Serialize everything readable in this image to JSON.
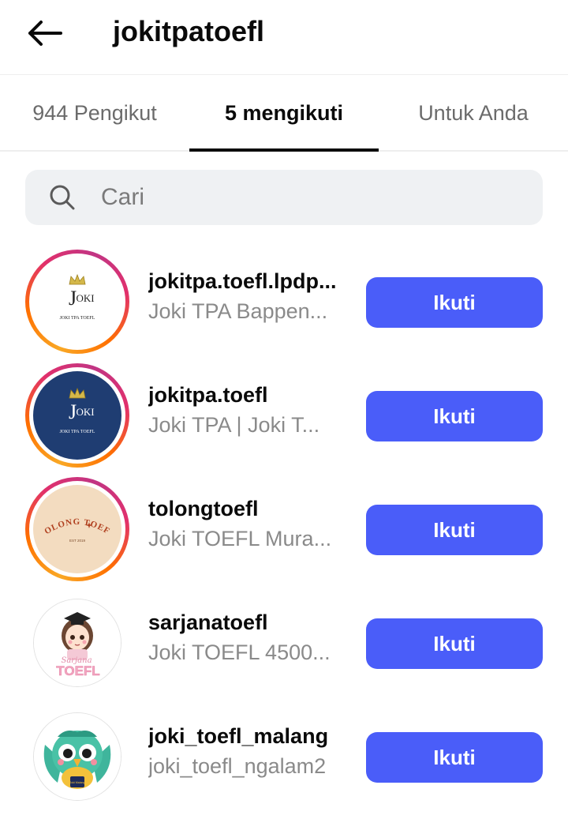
{
  "header": {
    "title": "jokitpatoefl",
    "back_icon": "arrow-left-icon"
  },
  "tabs": [
    {
      "label": "944 Pengikut",
      "active": false
    },
    {
      "label": "5 mengikuti",
      "active": true
    },
    {
      "label": "Untuk Anda",
      "active": false
    }
  ],
  "search": {
    "placeholder": "Cari",
    "value": "",
    "icon": "search-icon"
  },
  "colors": {
    "follow_button": "#4a5df9",
    "story_ring_start": "#f9a825",
    "story_ring_end": "#c13584"
  },
  "users": [
    {
      "username": "jokitpa.toefl.lpdp...",
      "subtitle": "Joki TPA Bappen...",
      "button": "Ikuti",
      "has_story_ring": true,
      "avatar_text": {
        "initial": "J",
        "suffix": "OKI",
        "caption": "JOKI TPA TOEFL"
      }
    },
    {
      "username": "jokitpa.toefl",
      "subtitle": "Joki TPA | Joki T...",
      "button": "Ikuti",
      "has_story_ring": true,
      "avatar_text": {
        "initial": "J",
        "suffix": "OKI",
        "caption": "JOKI TPA TOEFL"
      }
    },
    {
      "username": "tolongtoefl",
      "subtitle": "Joki TOEFL Mura...",
      "button": "Ikuti",
      "has_story_ring": true,
      "avatar_text": {
        "arc": "TOLONG TOEFL",
        "caption": "EST 2019"
      }
    },
    {
      "username": "sarjanatoefl",
      "subtitle": "Joki TOEFL 4500...",
      "button": "Ikuti",
      "has_story_ring": false,
      "avatar_text": {
        "script": "Sarjana",
        "big": "TOEFL"
      }
    },
    {
      "username": "joki_toefl_malang",
      "subtitle": "joki_toefl_ngalam2",
      "button": "Ikuti",
      "has_story_ring": false,
      "avatar_text": {
        "badge": "Joki Malang"
      }
    }
  ]
}
